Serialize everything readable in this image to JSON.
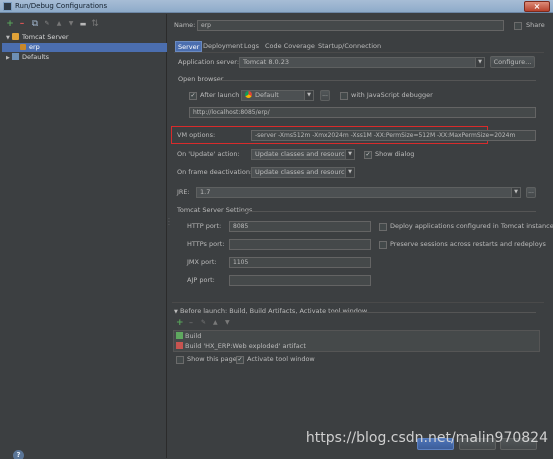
{
  "window": {
    "title": "Run/Debug Configurations"
  },
  "toolbar": {
    "add": "+",
    "remove": "–",
    "copy": "⧉",
    "move_up": "▲",
    "move_down": "▼",
    "folder": "▬",
    "sort": "⇅"
  },
  "tree": {
    "group_label": "Tomcat Server",
    "config_label": "erp",
    "defaults_label": "Defaults"
  },
  "name_row": {
    "label": "Name:",
    "value": "erp",
    "share_label": "Share"
  },
  "tabs": [
    {
      "label": "Server",
      "active": true
    },
    {
      "label": "Deployment",
      "active": false
    },
    {
      "label": "Logs",
      "active": false
    },
    {
      "label": "Code Coverage",
      "active": false
    },
    {
      "label": "Startup/Connection",
      "active": false
    }
  ],
  "server": {
    "app_server_label": "Application server:",
    "app_server_value": "Tomcat 8.0.23",
    "configure_label": "Configure...",
    "open_browser_label": "Open browser",
    "after_launch_label": "After launch",
    "after_launch_checked": true,
    "browser_value": "Default",
    "more_label": "...",
    "js_debugger_label": "with JavaScript debugger",
    "js_debugger_checked": false,
    "url_value": "http://localhost:8085/erp/",
    "vm_options_label": "VM options:",
    "vm_options_value": "-server -Xms512m -Xmx2024m -Xss1M -XX:PermSize=512M -XX:MaxPermSize=2024m",
    "on_update_label": "On 'Update' action:",
    "on_update_value": "Update classes and resources",
    "show_dialog_label": "Show dialog",
    "show_dialog_checked": true,
    "on_frame_label": "On frame deactivation:",
    "on_frame_value": "Update classes and resources",
    "jre_label": "JRE:",
    "jre_value": "1.7",
    "tomcat_settings_label": "Tomcat Server Settings",
    "http_port_label": "HTTP port:",
    "http_port_value": "8085",
    "https_port_label": "HTTPs port:",
    "https_port_value": "",
    "jmx_port_label": "JMX port:",
    "jmx_port_value": "1105",
    "ajp_port_label": "AJP port:",
    "ajp_port_value": "",
    "deploy_apps_label": "Deploy applications configured in Tomcat instance",
    "deploy_apps_checked": false,
    "preserve_sessions_label": "Preserve sessions across restarts and redeploys",
    "preserve_sessions_checked": false
  },
  "before_launch": {
    "header": "Before launch: Build, Build Artifacts, Activate tool window",
    "tasks": [
      "Build",
      "Build 'HX_ERP:Web exploded' artifact"
    ],
    "show_page_label": "Show this page",
    "show_page_checked": false,
    "activate_tool_label": "Activate tool window",
    "activate_tool_checked": true
  },
  "footer": {
    "help": "?"
  },
  "watermark": "https://blog.csdn.net/malin970824",
  "colors": {
    "background": "#3c3f41",
    "selection": "#4b6eaf",
    "highlight_box": "#d92b2b"
  }
}
